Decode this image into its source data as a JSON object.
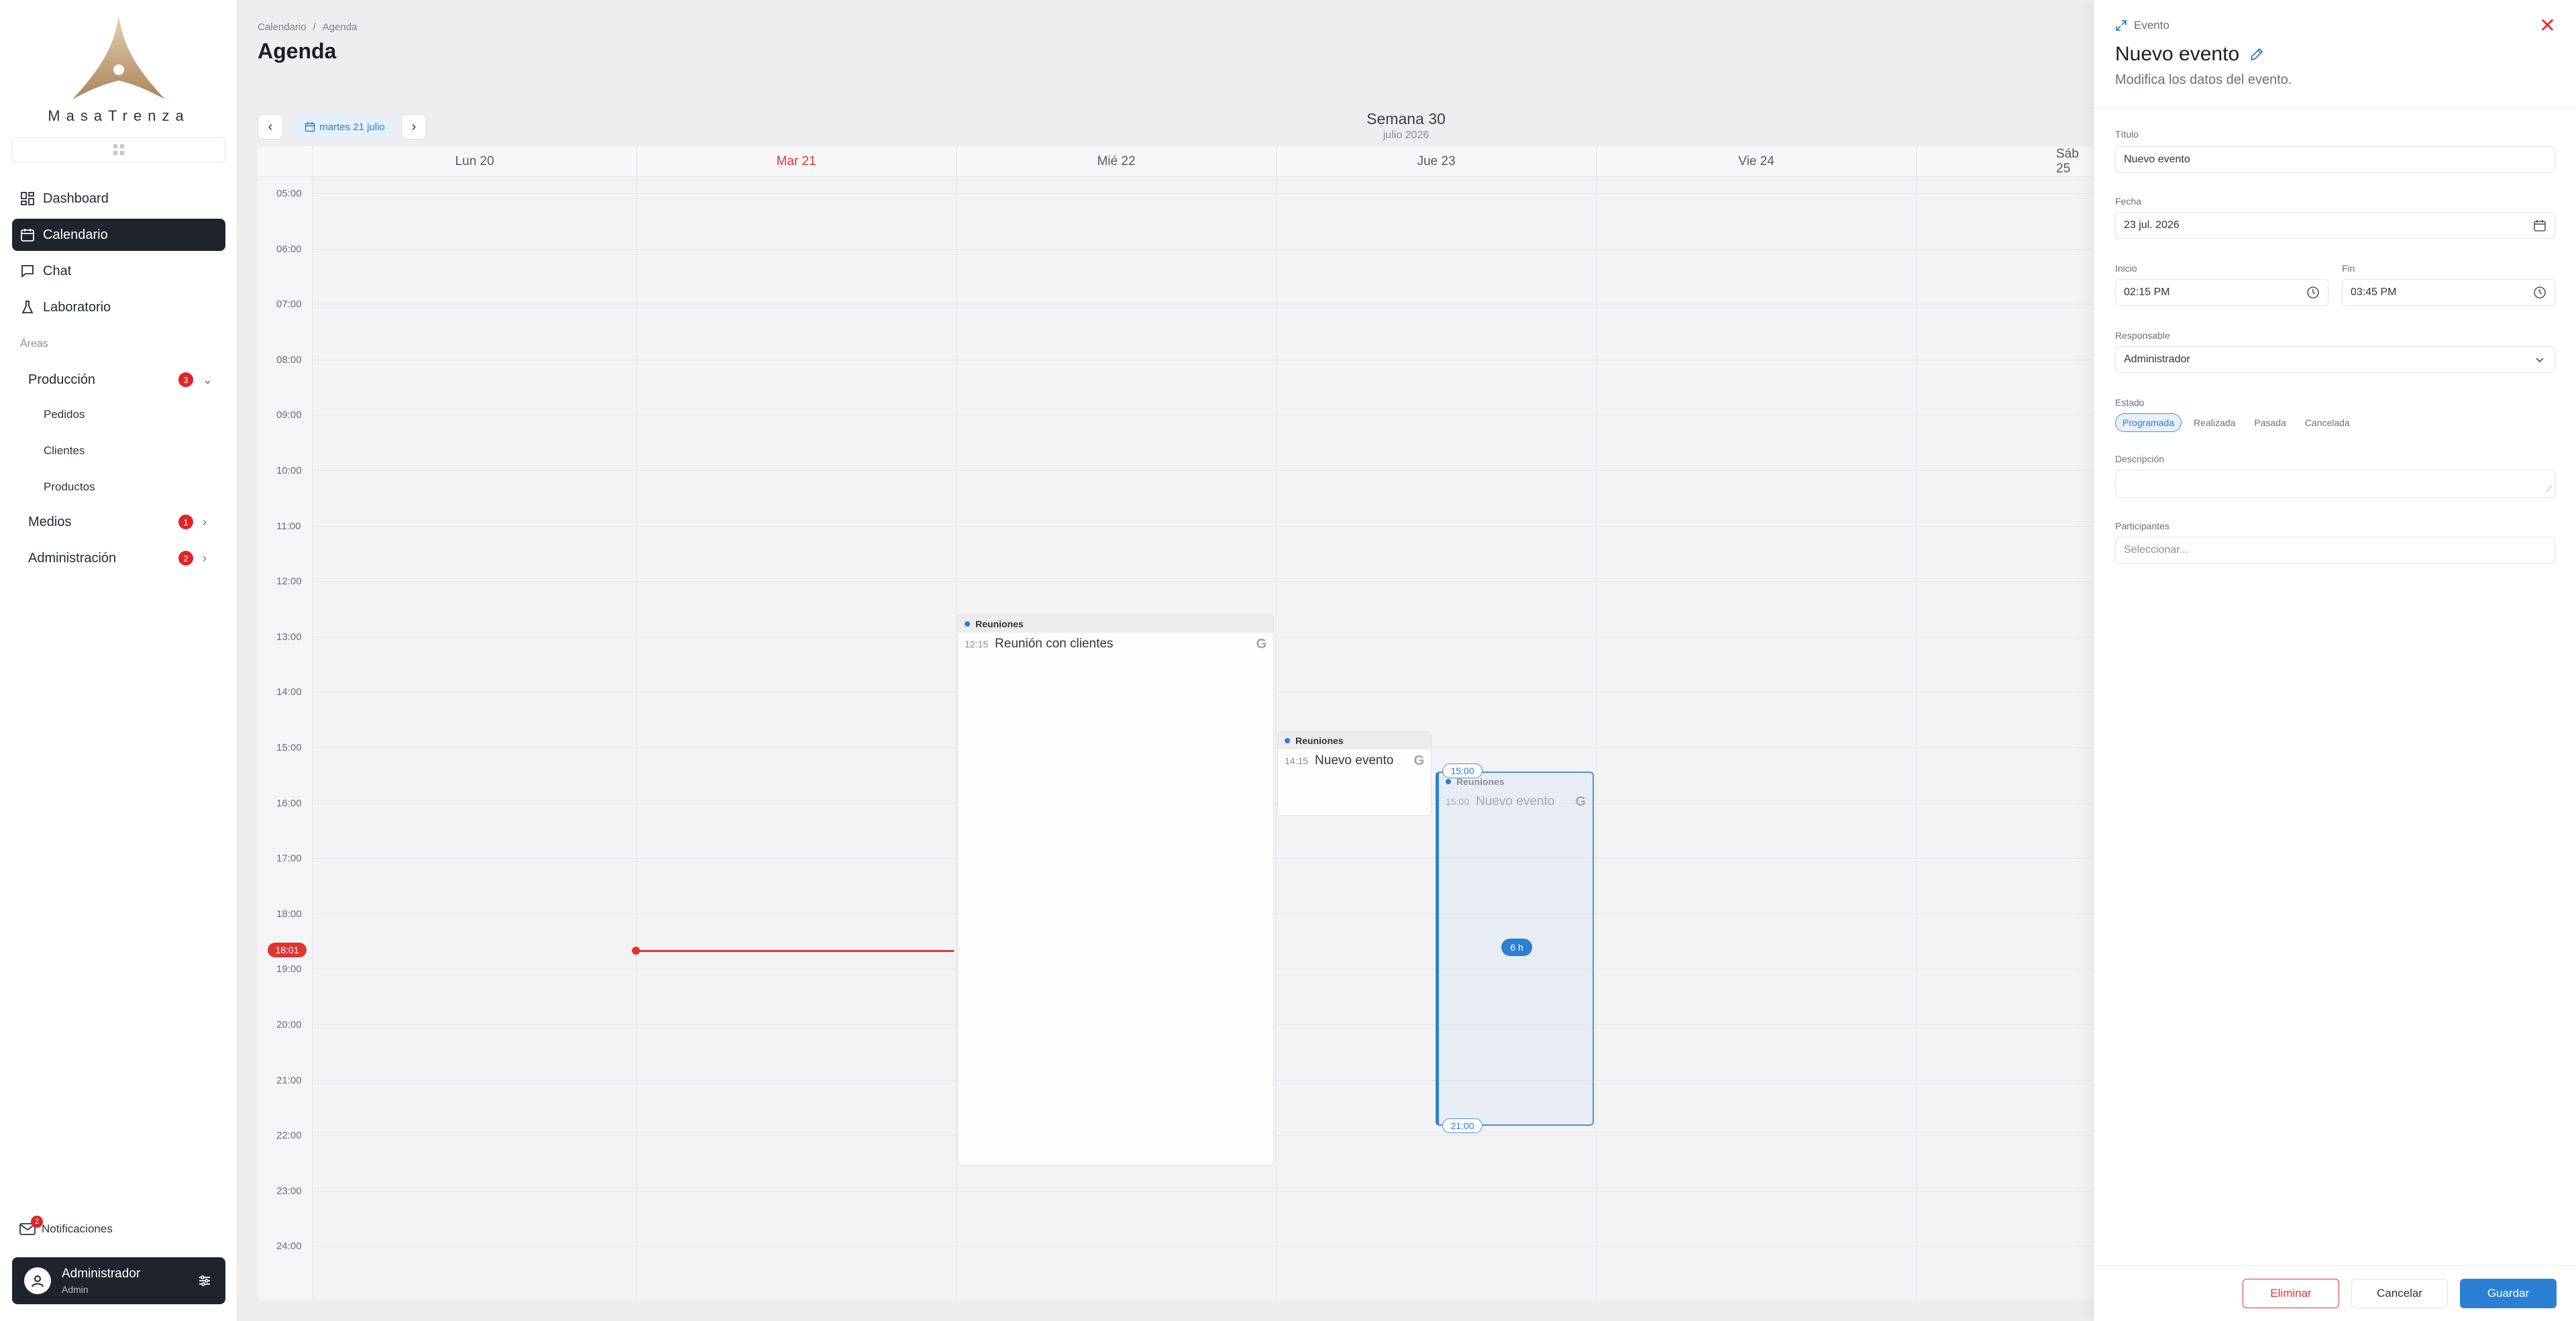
{
  "sidebar": {
    "brand": "MasaTrenza",
    "nav": [
      {
        "label": "Dashboard",
        "icon": "dashboard-icon"
      },
      {
        "label": "Calendario",
        "icon": "calendar-icon",
        "active": true
      },
      {
        "label": "Chat",
        "icon": "chat-icon"
      },
      {
        "label": "Laboratorio",
        "icon": "flask-icon"
      }
    ],
    "areas_label": "Áreas",
    "areas": [
      {
        "label": "Producción",
        "badge": "3",
        "expanded": true
      },
      {
        "label": "Medios",
        "badge": "1"
      },
      {
        "label": "Administración",
        "badge": "2"
      }
    ],
    "production_items": [
      "Pedidos",
      "Clientes",
      "Productos"
    ],
    "notifications": {
      "label": "Notificaciones",
      "count": "2"
    },
    "user": {
      "name": "Administrador",
      "role": "Admin"
    }
  },
  "header": {
    "breadcrumb": [
      "Calendario",
      "Agenda"
    ],
    "title": "Agenda",
    "date_pill": "martes 21 julio",
    "week_title": "Semana 30",
    "week_sub": "julio 2026"
  },
  "calendar": {
    "days": [
      {
        "label": "Lun 20"
      },
      {
        "label": "Mar 21",
        "today": true
      },
      {
        "label": "Mié 22"
      },
      {
        "label": "Jue 23"
      },
      {
        "label": "Vie 24"
      },
      {
        "label": "Sáb 25"
      }
    ],
    "hours": [
      "05:00",
      "06:00",
      "07:00",
      "08:00",
      "09:00",
      "10:00",
      "11:00",
      "12:00",
      "13:00",
      "14:00",
      "15:00",
      "16:00",
      "17:00",
      "18:00",
      "19:00",
      "20:00",
      "21:00",
      "22:00",
      "23:00",
      "24:00"
    ],
    "now": "18:01",
    "events": [
      {
        "category": "Reuniones",
        "time": "12:15",
        "title": "Reunión con clientes"
      },
      {
        "category": "Reuniones",
        "time": "14:15",
        "title": "Nuevo evento"
      },
      {
        "category": "Reuniones",
        "time": "15:00",
        "title": "Nuevo evento",
        "ghost": true
      }
    ],
    "drag": {
      "start": "15:00",
      "end": "21:00",
      "duration": "6 h"
    }
  },
  "panel": {
    "kicker": "Evento",
    "title": "Nuevo evento",
    "description": "Modifica los datos del evento.",
    "fields": {
      "title_label": "Título",
      "title_value": "Nuevo evento",
      "date_label": "Fecha",
      "date_value": "23 jul. 2026",
      "start_label": "Inicio",
      "start_value": "02:15 PM",
      "end_label": "Fin",
      "end_value": "03:45 PM",
      "owner_label": "Responsable",
      "owner_value": "Administrador",
      "status_label": "Estado",
      "statuses": [
        "Programada",
        "Realizada",
        "Pasada",
        "Cancelada"
      ],
      "selected_status": "Programada",
      "description_label": "Descripción",
      "participants_label": "Participantes",
      "participants_placeholder": "Seleccionar..."
    },
    "buttons": {
      "delete": "Eliminar",
      "cancel": "Cancelar",
      "save": "Guardar"
    }
  },
  "colors": {
    "accent": "#2b7fd4",
    "danger": "#e0342f",
    "dark": "#1e232c"
  }
}
